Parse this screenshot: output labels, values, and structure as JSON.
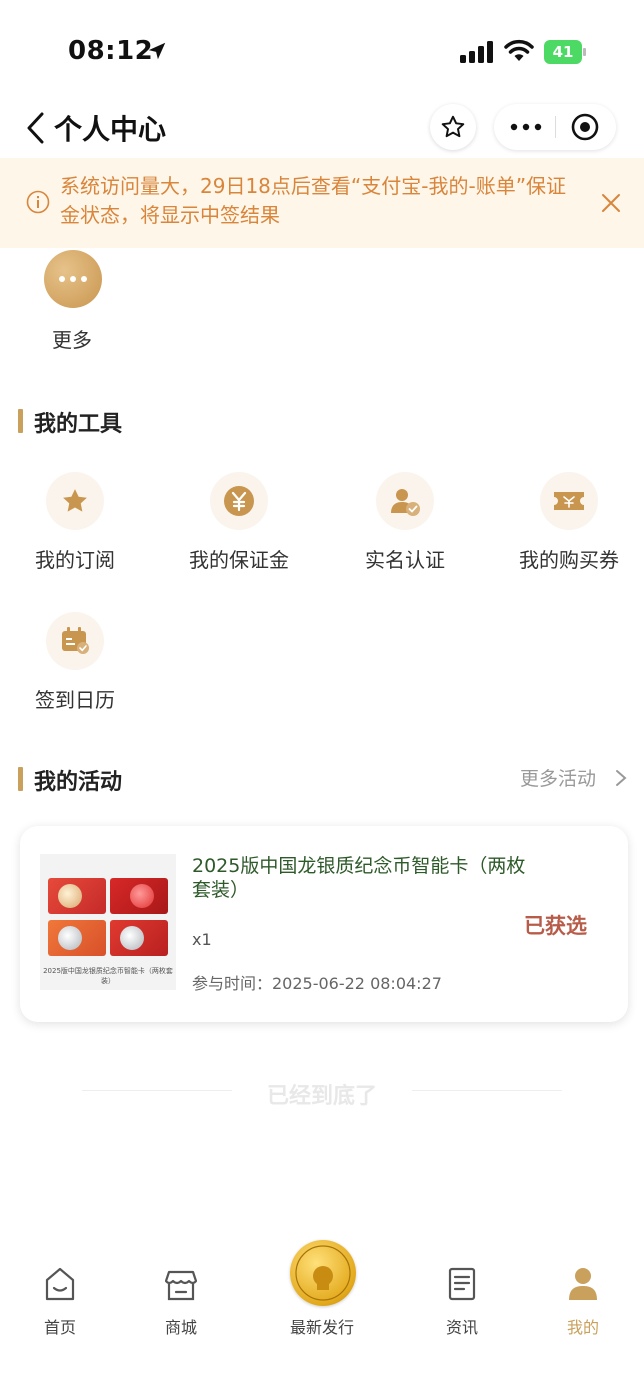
{
  "status_bar": {
    "time": "08:12",
    "battery": "41"
  },
  "nav": {
    "title": "个人中心"
  },
  "notice": {
    "text": "系统访问量大，29日18点后查看“支付宝-我的-账单”保证金状态，将显示中签结果"
  },
  "top_more": {
    "label": "更多"
  },
  "tools_section": {
    "title": "我的工具",
    "items": [
      {
        "label": "我的订阅",
        "icon": "star-icon"
      },
      {
        "label": "我的保证金",
        "icon": "yuan-icon"
      },
      {
        "label": "实名认证",
        "icon": "verified-user-icon"
      },
      {
        "label": "我的购买券",
        "icon": "ticket-icon"
      },
      {
        "label": "签到日历",
        "icon": "calendar-check-icon"
      }
    ]
  },
  "activities_section": {
    "title": "我的活动",
    "more_label": "更多活动",
    "items": [
      {
        "title": "2025版中国龙银质纪念币智能卡（两枚套装）",
        "quantity": "x1",
        "join_time": "参与时间：2025-06-22 08:04:27",
        "status": "已获选",
        "thumb_caption": "2025版中国龙银质纪念币智能卡（两枚套装）"
      }
    ]
  },
  "end_text": "已经到底了",
  "tab_bar": {
    "tabs": [
      {
        "label": "首页",
        "icon": "home-icon"
      },
      {
        "label": "商城",
        "icon": "store-icon"
      },
      {
        "label": "最新发行",
        "icon": "coin-icon"
      },
      {
        "label": "资讯",
        "icon": "news-icon"
      },
      {
        "label": "我的",
        "icon": "user-icon",
        "active": true
      }
    ]
  },
  "colors": {
    "accent_gold": "#c9a15c",
    "notice_text": "#d9853b",
    "notice_bg": "#fdf6e9",
    "status_selected": "#b85c4a",
    "card_title": "#2e5a2a"
  }
}
